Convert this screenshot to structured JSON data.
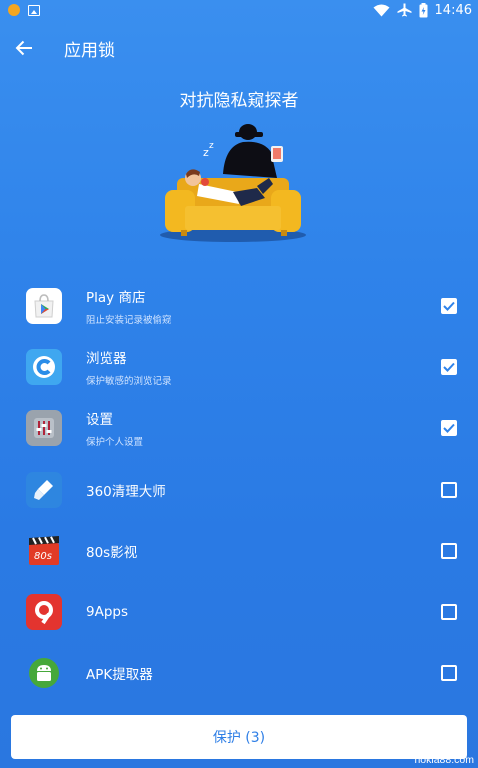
{
  "status_bar": {
    "time": "14:46",
    "icons": [
      "notification-icon",
      "image-icon",
      "wifi-icon",
      "airplane-icon",
      "battery-icon"
    ]
  },
  "app_bar": {
    "back_icon": "arrow-left-icon",
    "title": "应用锁"
  },
  "headline": "对抗隐私窥探者",
  "apps": [
    {
      "name": "Play 商店",
      "desc": "阻止安装记录被偷窥",
      "icon": "play-store-icon",
      "checked": true
    },
    {
      "name": "浏览器",
      "desc": "保护敏感的浏览记录",
      "icon": "browser-icon",
      "checked": true
    },
    {
      "name": "设置",
      "desc": "保护个人设置",
      "icon": "settings-icon",
      "checked": true
    },
    {
      "name": "360清理大师",
      "desc": "",
      "icon": "360-clean-icon",
      "checked": false
    },
    {
      "name": "80s影视",
      "desc": "",
      "icon": "80s-video-icon",
      "checked": false
    },
    {
      "name": "9Apps",
      "desc": "",
      "icon": "9apps-icon",
      "checked": false
    },
    {
      "name": "APK提取器",
      "desc": "",
      "icon": "android-icon",
      "checked": false
    }
  ],
  "protect_button": "保护 (3)",
  "watermark": "nokia88.com",
  "colors": {
    "background": "#2f83ea",
    "button_text": "#2f7fe6"
  }
}
